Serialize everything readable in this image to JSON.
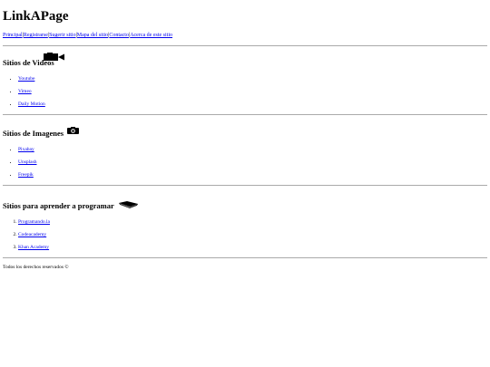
{
  "site": {
    "title": "LinkAPage"
  },
  "nav": {
    "items": [
      "Principal",
      "Registrarse",
      "Sugerir sitio",
      "Mapa del sitio",
      "Contacto",
      "Acerca de este sitio"
    ],
    "separator": "|"
  },
  "sections": {
    "videos": {
      "heading": "Sitios de Videos",
      "icon": "video-camera-icon",
      "links": [
        "Youtube",
        "Vimeo",
        "Daily Motion"
      ]
    },
    "images": {
      "heading": "Sitios de Imagenes",
      "icon": "photo-camera-icon",
      "links": [
        "Pixabay",
        "Unsplash",
        "Freepik"
      ]
    },
    "learning": {
      "heading": "Sitios para aprender a programar",
      "icon": "open-book-icon",
      "links": [
        "Programando.la",
        "Codeacademy",
        "Khan Academy"
      ]
    }
  },
  "footer": {
    "text": "Todos los derechos reservados ©"
  },
  "colors": {
    "link": "#0000ee",
    "divider": "#aaaaaa"
  }
}
